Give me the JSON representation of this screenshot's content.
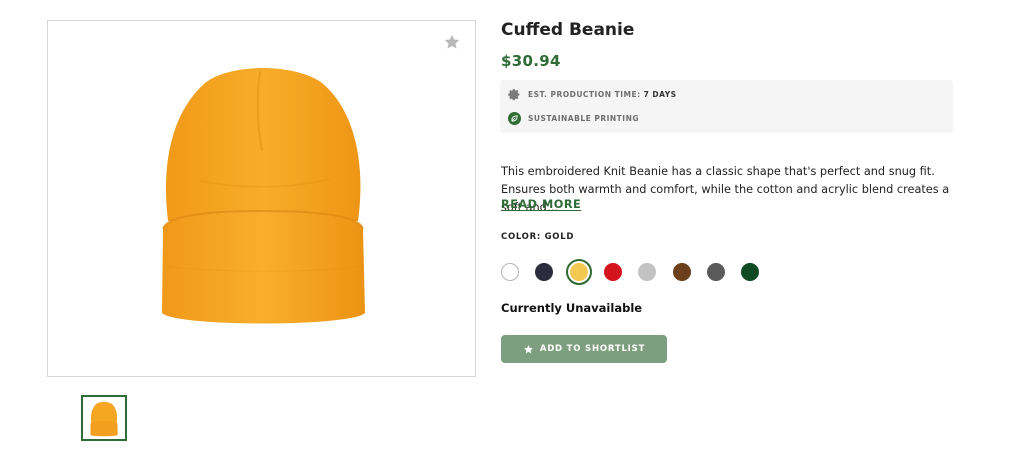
{
  "product": {
    "title": "Cuffed Beanie",
    "price": "$30.94",
    "image_icon": "beanie-image",
    "favorite_icon": "star-icon"
  },
  "info": {
    "production_label": "EST. PRODUCTION TIME:",
    "production_value": "7 DAYS",
    "production_icon": "gear-icon",
    "sustainable_label": "SUSTAINABLE PRINTING",
    "sustainable_icon": "leaf-icon"
  },
  "description": {
    "text": "This embroidered Knit Beanie has a classic shape that's perfect and snug fit. Ensures both warmth and comfort, while the cotton and acrylic blend creates a soft and…",
    "read_more_label": "READ MORE"
  },
  "color": {
    "label": "COLOR: GOLD",
    "swatches": [
      {
        "color": "#ffffff",
        "border": "#b5b5b5",
        "selected": false
      },
      {
        "color": "#2b2d3e",
        "border": "#2b2d3e",
        "selected": false
      },
      {
        "color": "#f3c953",
        "border": "#2e6b35",
        "selected": true
      },
      {
        "color": "#d4131f",
        "border": "#d4131f",
        "selected": false
      },
      {
        "color": "#c2c2c2",
        "border": "#c2c2c2",
        "selected": false
      },
      {
        "color": "#6b3f1b",
        "border": "#6b3f1b",
        "selected": false
      },
      {
        "color": "#5a5a5a",
        "border": "#5a5a5a",
        "selected": false
      },
      {
        "color": "#0f4a25",
        "border": "#0f4a25",
        "selected": false
      }
    ]
  },
  "availability": "Currently Unavailable",
  "shortlist_button": {
    "label": "ADD TO SHORTLIST",
    "icon": "star-icon"
  },
  "colors": {
    "accent": "#2e6b35",
    "button": "#7d9f80",
    "beanie": "#f5a623"
  }
}
